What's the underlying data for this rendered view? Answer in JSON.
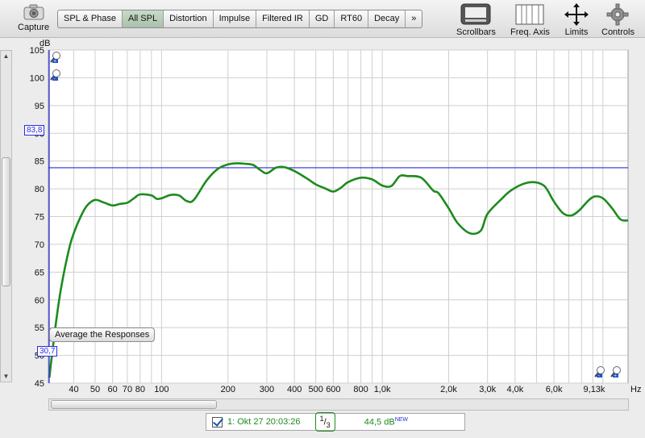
{
  "toolbar": {
    "capture_label": "Capture",
    "tabs": [
      {
        "label": "SPL & Phase",
        "active": false
      },
      {
        "label": "All SPL",
        "active": true
      },
      {
        "label": "Distortion",
        "active": false
      },
      {
        "label": "Impulse",
        "active": false
      },
      {
        "label": "Filtered IR",
        "active": false
      },
      {
        "label": "GD",
        "active": false
      },
      {
        "label": "RT60",
        "active": false
      },
      {
        "label": "Decay",
        "active": false
      },
      {
        "label": "»",
        "active": false
      }
    ],
    "right_tools": [
      "Scrollbars",
      "Freq. Axis",
      "Limits",
      "Controls"
    ],
    "icons": {
      "capture": "camera-icon",
      "scrollbars": "scrollbars-icon",
      "freq_axis": "freq-axis-icon",
      "limits": "limits-icon",
      "controls": "gear-icon"
    }
  },
  "chart": {
    "unit_y": "dB",
    "unit_x": "Hz",
    "cursor_y_readout": "83,8",
    "cursor_x_readout": "30,7",
    "average_button": "Average the Responses"
  },
  "legend": {
    "checked": true,
    "name": "1: Okt 27 20:03:26",
    "smoothing_num": "1",
    "smoothing_den": "3",
    "level": "44,5 dB",
    "badge": "NEW"
  },
  "colors": {
    "trace": "#1e8b1e",
    "cursor": "#2a2ae0",
    "grid": "#cfcfcf",
    "active_tab": "#b3c8b4"
  },
  "chart_data": {
    "type": "line",
    "ylabel": "dB",
    "xlabel": "Hz",
    "x_scale": "log",
    "xlim": [
      30.7,
      13000
    ],
    "ylim": [
      45,
      105
    ],
    "grid": true,
    "y_ticks": [
      45,
      50,
      55,
      60,
      65,
      70,
      75,
      80,
      85,
      90,
      95,
      100,
      105
    ],
    "x_ticks": [
      {
        "v": 40,
        "label": "40"
      },
      {
        "v": 50,
        "label": "50"
      },
      {
        "v": 60,
        "label": "60"
      },
      {
        "v": 70,
        "label": "70"
      },
      {
        "v": 80,
        "label": "80"
      },
      {
        "v": 100,
        "label": "100"
      },
      {
        "v": 200,
        "label": "200"
      },
      {
        "v": 300,
        "label": "300"
      },
      {
        "v": 400,
        "label": "400"
      },
      {
        "v": 500,
        "label": "500"
      },
      {
        "v": 600,
        "label": "600"
      },
      {
        "v": 800,
        "label": "800"
      },
      {
        "v": 1000,
        "label": "1,0k"
      },
      {
        "v": 2000,
        "label": "2,0k"
      },
      {
        "v": 3000,
        "label": "3,0k"
      },
      {
        "v": 4000,
        "label": "4,0k"
      },
      {
        "v": 6000,
        "label": "6,0k"
      },
      {
        "v": 9130,
        "label": "9,13k"
      }
    ],
    "cursor_level": 83.8,
    "series": [
      {
        "x": [
          31,
          33,
          35,
          38,
          40,
          43,
          46,
          50,
          55,
          60,
          65,
          70,
          75,
          80,
          90,
          95,
          100,
          110,
          120,
          130,
          140,
          160,
          180,
          200,
          220,
          240,
          260,
          280,
          300,
          330,
          360,
          400,
          450,
          500,
          550,
          600,
          650,
          700,
          800,
          900,
          1000,
          1100,
          1200,
          1300,
          1500,
          1700,
          1800,
          2000,
          2200,
          2500,
          2800,
          3000,
          3500,
          3800,
          4300,
          4800,
          5300,
          5600,
          6000,
          6600,
          7200,
          7800,
          8500,
          9130,
          10000,
          11000,
          12000,
          13000
        ],
        "y": [
          46,
          55,
          62,
          69,
          72,
          75,
          77,
          78,
          77.5,
          77,
          77.3,
          77.5,
          78.3,
          79,
          78.8,
          78.2,
          78.3,
          78.9,
          78.8,
          77.8,
          78,
          81.5,
          83.6,
          84.4,
          84.6,
          84.5,
          84.3,
          83.4,
          82.8,
          83.8,
          83.9,
          83.2,
          82,
          80.8,
          80.1,
          79.5,
          80.2,
          81.2,
          82,
          81.7,
          80.6,
          80.5,
          82.3,
          82.3,
          82,
          79.7,
          79.2,
          76.5,
          73.8,
          72,
          72.5,
          75.5,
          78.3,
          79.6,
          80.8,
          81.2,
          80.8,
          79.8,
          77.7,
          75.6,
          75.2,
          76.1,
          77.7,
          78.6,
          78.3,
          76.5,
          74.5,
          74.3
        ]
      }
    ]
  }
}
